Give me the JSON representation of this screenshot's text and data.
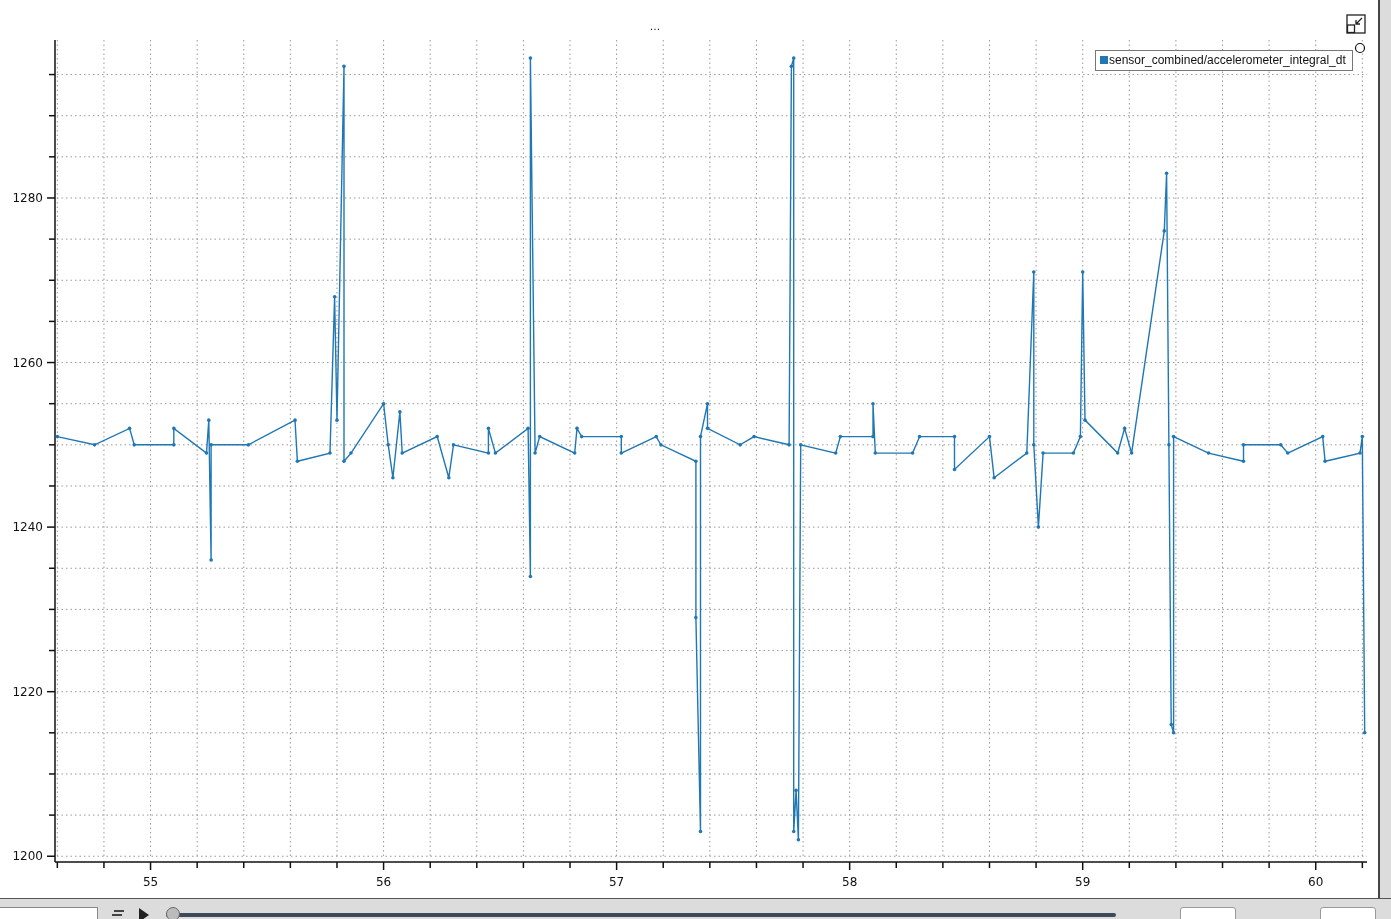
{
  "plot": {
    "chart_data": {
      "type": "line",
      "grid": true,
      "title": "...",
      "xlim": [
        54.59,
        60.22
      ],
      "ylim": [
        1199.3,
        1299.2
      ],
      "xticks": [
        55,
        56,
        57,
        58,
        59,
        60
      ],
      "yticks": [
        1200,
        1220,
        1240,
        1260,
        1280
      ],
      "x": [
        54.6,
        54.76,
        54.91,
        54.93,
        55.1,
        55.1,
        55.24,
        55.25,
        55.26,
        55.26,
        55.42,
        55.62,
        55.63,
        55.77,
        55.79,
        55.8,
        55.83,
        55.83,
        55.86,
        56.0,
        56.02,
        56.04,
        56.07,
        56.08,
        56.23,
        56.28,
        56.3,
        56.45,
        56.45,
        56.48,
        56.62,
        56.63,
        56.63,
        56.65,
        56.67,
        56.82,
        56.83,
        56.85,
        57.02,
        57.02,
        57.17,
        57.19,
        57.34,
        57.34,
        57.36,
        57.36,
        57.39,
        57.39,
        57.53,
        57.59,
        57.74,
        57.75,
        57.76,
        57.76,
        57.77,
        57.78,
        57.79,
        57.94,
        57.96,
        58.1,
        58.1,
        58.11,
        58.27,
        58.3,
        58.45,
        58.45,
        58.6,
        58.62,
        58.76,
        58.79,
        58.79,
        58.81,
        58.83,
        58.96,
        58.99,
        59.0,
        59.01,
        59.15,
        59.18,
        59.21,
        59.35,
        59.36,
        59.37,
        59.38,
        59.39,
        59.39,
        59.54,
        59.69,
        59.69,
        59.85,
        59.88,
        60.03,
        60.04,
        60.19,
        60.2,
        60.21
      ],
      "series": [
        {
          "name": "sensor_combined/accelerometer_integral_dt",
          "color": "#1f77b4",
          "values": [
            1251,
            1250,
            1252,
            1250,
            1250,
            1252,
            1249,
            1253,
            1236,
            1250,
            1250,
            1253,
            1248,
            1249,
            1268,
            1253,
            1296,
            1248,
            1249,
            1255,
            1250,
            1246,
            1254,
            1249,
            1251,
            1246,
            1250,
            1249,
            1252,
            1249,
            1252,
            1234,
            1297,
            1249,
            1251,
            1249,
            1252,
            1251,
            1251,
            1249,
            1251,
            1250,
            1248,
            1229,
            1203,
            1251,
            1255,
            1252,
            1250,
            1251,
            1250,
            1296,
            1297,
            1203,
            1208,
            1202,
            1250,
            1249,
            1251,
            1251,
            1255,
            1249,
            1249,
            1251,
            1251,
            1247,
            1251,
            1246,
            1249,
            1271,
            1250,
            1240,
            1249,
            1249,
            1251,
            1271,
            1253,
            1249,
            1252,
            1249,
            1276,
            1283,
            1250,
            1216,
            1215,
            1251,
            1249,
            1248,
            1250,
            1250,
            1249,
            1251,
            1248,
            1249,
            1251,
            1215
          ]
        }
      ]
    }
  },
  "timeline": {
    "level": 0
  }
}
